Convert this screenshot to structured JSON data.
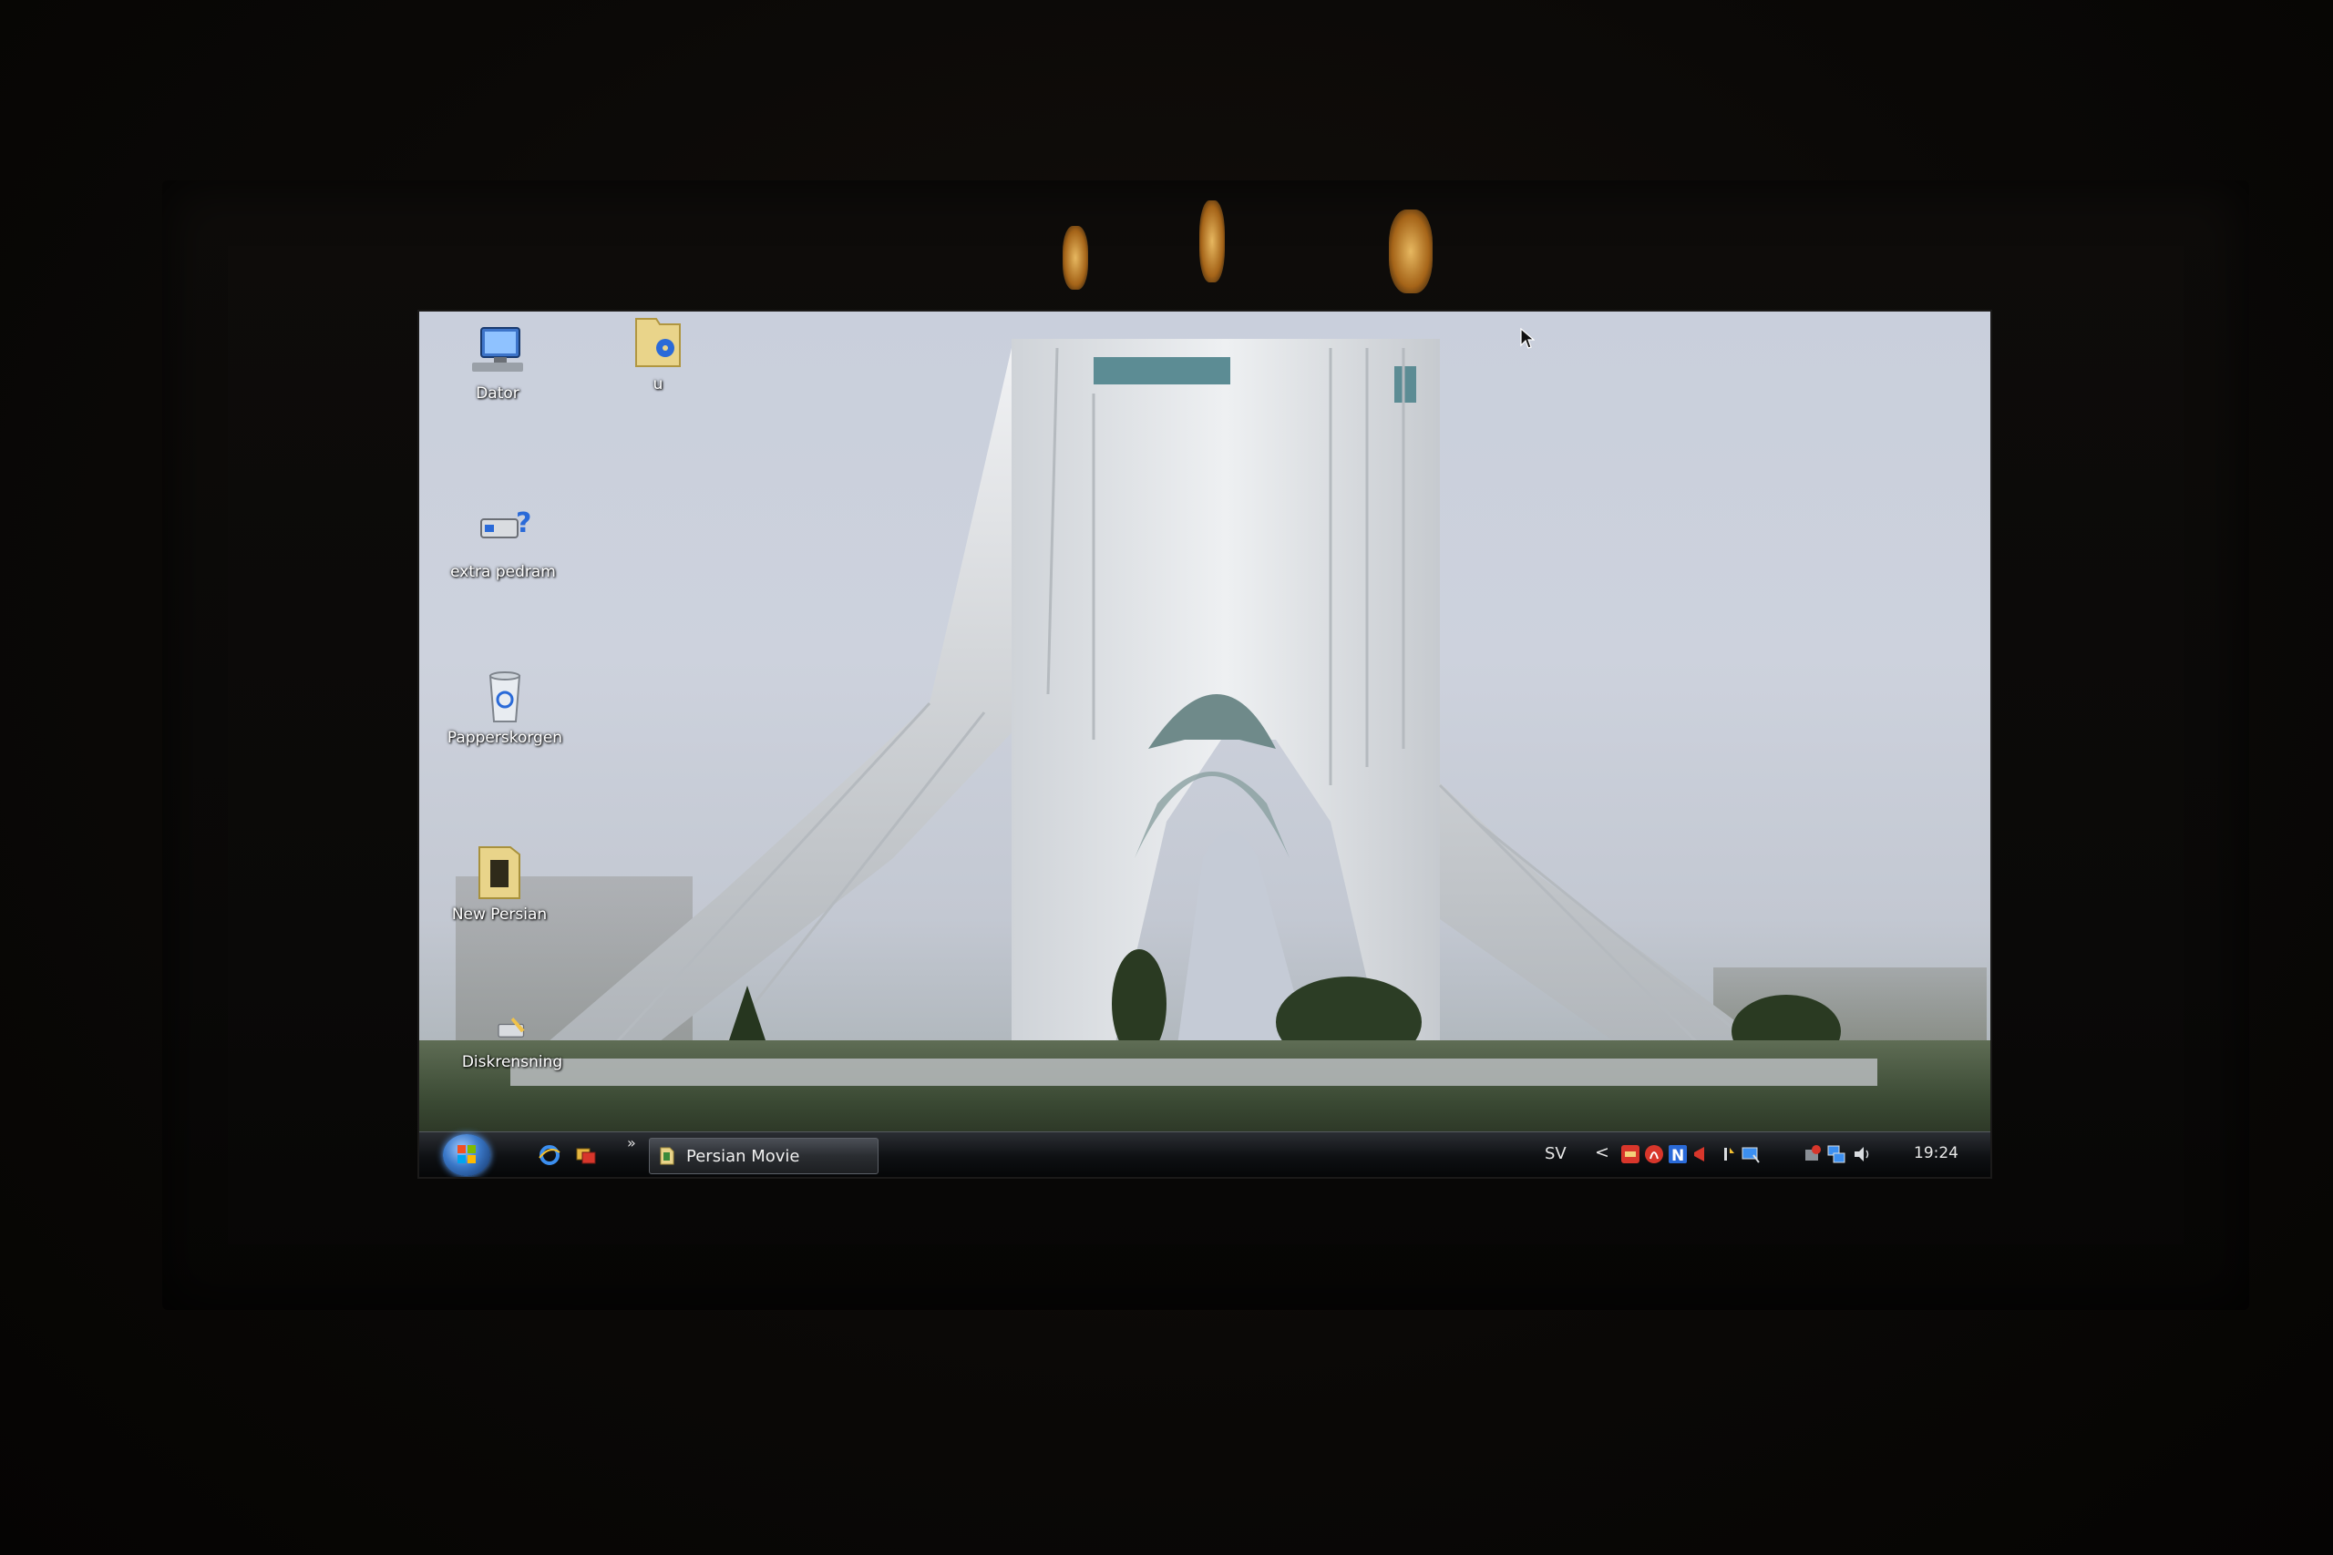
{
  "desktop": {
    "icons": [
      {
        "label": "Dator",
        "icon": "computer-icon"
      },
      {
        "label": "u",
        "icon": "folder-icon"
      },
      {
        "label": "extra pedram",
        "icon": "network-drive-icon"
      },
      {
        "label": "Papperskorgen",
        "icon": "recycle-bin-icon"
      },
      {
        "label": "New Persian",
        "icon": "folder-icon"
      },
      {
        "label": "Diskrensning",
        "icon": "disk-cleanup-icon"
      }
    ],
    "wallpaper": "Azadi Tower"
  },
  "taskbar": {
    "start": "start-orb-icon",
    "quick_launch": [
      "internet-explorer-icon",
      "switch-windows-icon"
    ],
    "quick_launch_more": "»",
    "task_label": "Persian Movie",
    "language": "SV",
    "tray_chevron": "<",
    "clock": "19:24"
  },
  "colors": {
    "taskbar": "#0e1013",
    "orb": "#3a78c8",
    "tray_red": "#d8362b",
    "tray_blue": "#2a6ad8"
  }
}
